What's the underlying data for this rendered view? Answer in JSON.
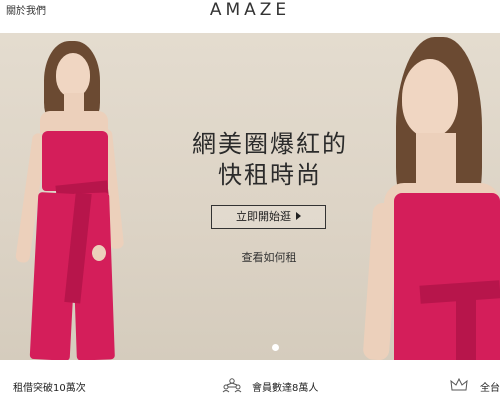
{
  "header": {
    "about_label": "關於我們",
    "logo_text": "AMAZE"
  },
  "hero": {
    "headline_line1": "網美圈爆紅的",
    "headline_line2": "快租時尚",
    "cta_label": "立即開始逛",
    "howto_label": "查看如何租",
    "dress_color": "#d41e5a",
    "carousel_active_index": 1
  },
  "stats": {
    "rentals_label": "租借突破10萬次",
    "members_label": "會員數達8萬人",
    "third_label": "全台",
    "members_icon": "people-network-icon",
    "third_icon": "crown-icon"
  }
}
